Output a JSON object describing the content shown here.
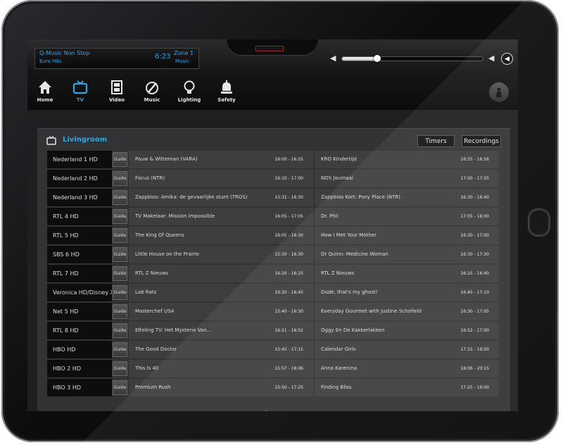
{
  "now_playing": {
    "station": "Q-Music Non Stop",
    "track": "Euro Hits",
    "time": "6:23",
    "zone": "Zone 1",
    "zone_source": "Music"
  },
  "volume": {
    "level": 0.25
  },
  "nav": [
    {
      "label": "Home",
      "icon": "home-icon",
      "active": false
    },
    {
      "label": "TV",
      "icon": "tv-icon",
      "active": true
    },
    {
      "label": "Video",
      "icon": "film-icon",
      "active": false
    },
    {
      "label": "Music",
      "icon": "music-icon",
      "active": false
    },
    {
      "label": "Lighting",
      "icon": "lightbulb-icon",
      "active": false
    },
    {
      "label": "Safety",
      "icon": "alarm-icon",
      "active": false
    }
  ],
  "panel": {
    "title": "Livingroom",
    "timers_label": "Timers",
    "recordings_label": "Recordings",
    "guide_label": "Guide"
  },
  "channels": [
    {
      "name": "Nederland 1 HD",
      "now": "Pauw & Witteman (VARA)",
      "now_time": "16:00 - 16:55",
      "next": "KRO Kindertijd",
      "next_time": "16:55 - 16:56"
    },
    {
      "name": "Nederland 2 HD",
      "now": "Focus (NTR)",
      "now_time": "16:10 - 17:00",
      "next": "NOS Journaal",
      "next_time": "17:00 - 17:05"
    },
    {
      "name": "Nederland 3 HD",
      "now": "Zappbios: Amika: de gevaarlijke stunt (TROS)",
      "now_time": "15:31 - 16:30",
      "next": "Zappbios Kort: Pony Place (NTR)",
      "next_time": "16:30 - 16:40"
    },
    {
      "name": "RTL 4 HD",
      "now": "TV Makelaar: Mission Impossible",
      "now_time": "16:05 - 17:05",
      "next": "Dr. Phil",
      "next_time": "17:05 - 18:00"
    },
    {
      "name": "RTL 5 HD",
      "now": "The King Of Queens",
      "now_time": "16:05 - 16:30",
      "next": "How I Met Your Mother",
      "next_time": "16:30 - 17:00"
    },
    {
      "name": "SBS 6 HD",
      "now": "Little House on the Prairie",
      "now_time": "15:30 - 16:30",
      "next": "Dr Quinn: Medicine Woman",
      "next_time": "16:30 - 17:30"
    },
    {
      "name": "RTL 7 HD",
      "now": "RTL Z Nieuws",
      "now_time": "16:20 - 16:25",
      "next": "RTL Z Nieuws",
      "next_time": "16:25 - 16:40"
    },
    {
      "name": "Veronica HD/Disney XD",
      "now": "Lab Rats",
      "now_time": "16:20 - 16:45",
      "next": "Dude, that's my ghost!",
      "next_time": "16:45 - 17:10"
    },
    {
      "name": "Net 5 HD",
      "now": "Masterchef USA",
      "now_time": "15:40 - 16:30",
      "next": "Everyday Gourmet with Justine Schofield",
      "next_time": "16:30 - 17:05"
    },
    {
      "name": "RTL 8 HD",
      "now": "Efteling TV: Het Mysterie Van...",
      "now_time": "16:21 - 16:52",
      "next": "Oggy En De Kakkerlakken",
      "next_time": "16:52 - 17:00"
    },
    {
      "name": "HBO HD",
      "now": "The Good Doctor",
      "now_time": "15:45 - 17:15",
      "next": "Calendar Girls",
      "next_time": "17:15 - 19:00"
    },
    {
      "name": "HBO 2 HD",
      "now": "This Is 40",
      "now_time": "15:57 - 18:06",
      "next": "Anna Karenina",
      "next_time": "18:06 - 20:15"
    },
    {
      "name": "HBO 3 HD",
      "now": "Premium Rush",
      "now_time": "15:50 - 17:25",
      "next": "Finding Bliss",
      "next_time": "17:25 - 19:00"
    }
  ]
}
